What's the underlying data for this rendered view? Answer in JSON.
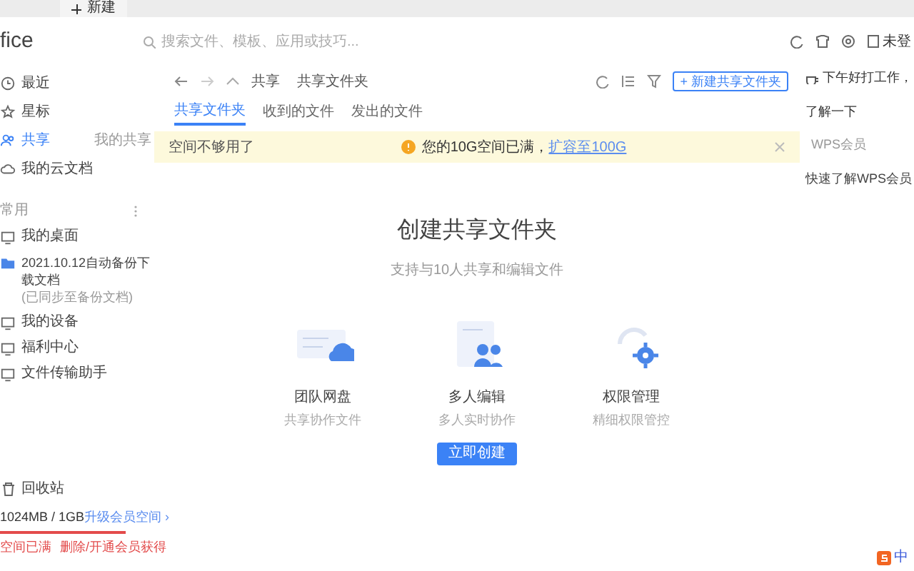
{
  "tab_bar": {
    "new_tab": "新建"
  },
  "logo": "fice",
  "search": {
    "placeholder": "搜索文件、模板、应用或技巧..."
  },
  "header": {
    "user": "未登"
  },
  "sidebar": {
    "items": [
      {
        "label": "最近",
        "kind": "clock",
        "selected": false
      },
      {
        "label": "星标",
        "kind": "star",
        "selected": false
      },
      {
        "label": "共享",
        "kind": "people",
        "selected": true,
        "extra": "我的共享"
      },
      {
        "label": "我的云文档",
        "kind": "cloud",
        "selected": false
      }
    ],
    "section": "常用",
    "common": [
      {
        "label": "我的桌面",
        "kind": "monitor"
      },
      {
        "label": "2021.10.12自动备份下载文档",
        "sub": "(已同步至备份文档)",
        "kind": "folder"
      },
      {
        "label": "我的设备",
        "kind": "monitor"
      },
      {
        "label": "福利中心",
        "kind": "monitor"
      },
      {
        "label": "文件传输助手",
        "kind": "monitor"
      }
    ],
    "trash": "回收站",
    "storage": {
      "usage": "1024MB / 1GB",
      "upgrade": "升级会员空间 ›",
      "level": 1,
      "warning": "空间已满",
      "warning_action": "删除/开通会员获得"
    }
  },
  "breadcrumb": [
    "共享",
    "共享文件夹"
  ],
  "new_button": "+ 新建共享文件夹",
  "tabs": [
    {
      "label": "共享文件夹",
      "selected": true
    },
    {
      "label": "收到的文件",
      "selected": false
    },
    {
      "label": "发出的文件",
      "selected": false
    }
  ],
  "banner": {
    "left": "空间不够用了",
    "message": "您的10G空间已满，",
    "link": "扩容至100G"
  },
  "empty": {
    "title": "创建共享文件夹",
    "subtitle": "支持与10人共享和编辑文件",
    "features": [
      {
        "kind": "disk",
        "title": "团队网盘",
        "desc": "共享协作文件"
      },
      {
        "kind": "edit",
        "title": "多人编辑",
        "desc": "多人实时协作"
      },
      {
        "kind": "perm",
        "title": "权限管理",
        "desc": "精细权限管控"
      }
    ],
    "button": "立即创建"
  },
  "right_panel": {
    "greeting": "下午好打工作，",
    "learn": "了解一下",
    "items": [
      "WPS会员",
      "快速了解WPS会员"
    ]
  },
  "ime": {
    "label": "中"
  }
}
